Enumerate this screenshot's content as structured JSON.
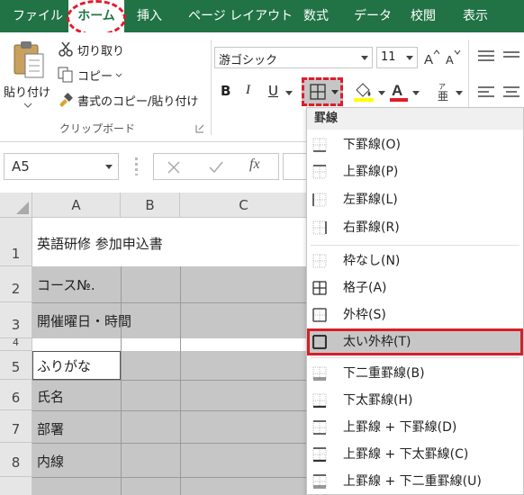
{
  "ribbon": {
    "tabs": [
      "ファイル",
      "ホーム",
      "挿入",
      "ページ レイアウト",
      "数式",
      "データ",
      "校閲",
      "表示"
    ],
    "clipboard": {
      "paste_label": "貼り付け",
      "cut_label": "切り取り",
      "copy_label": "コピー",
      "format_painter_label": "書式のコピー/貼り付け",
      "group_label": "クリップボード"
    },
    "font": {
      "font_name": "游ゴシック",
      "font_size": "11",
      "bold": "B",
      "italic": "I",
      "underline": "U"
    }
  },
  "formula_bar": {
    "name_box": "A5",
    "fx": "fx"
  },
  "sheet": {
    "columns": [
      "A",
      "B",
      "C"
    ],
    "rows": [
      "1",
      "2",
      "3",
      "4",
      "5",
      "6",
      "7",
      "8"
    ],
    "cells": {
      "title": "英語研修 参加申込書",
      "course_no": "コース№.",
      "datetime": "開催曜日・時間",
      "furigana": "ふりがな",
      "name": "氏名",
      "department": "部署",
      "extension": "内線"
    }
  },
  "border_menu": {
    "header": "罫線",
    "items": [
      "下罫線(O)",
      "上罫線(P)",
      "左罫線(L)",
      "右罫線(R)",
      "枠なし(N)",
      "格子(A)",
      "外枠(S)",
      "太い外枠(T)",
      "下二重罫線(B)",
      "下太罫線(H)",
      "上罫線 + 下罫線(D)",
      "上罫線 + 下太罫線(C)",
      "上罫線 + 下二重罫線(U)"
    ],
    "selected_index": 7
  },
  "colors": {
    "excel_green": "#217346",
    "highlight_red": "#e01c2b",
    "cell_shade": "#c6c6c6"
  }
}
